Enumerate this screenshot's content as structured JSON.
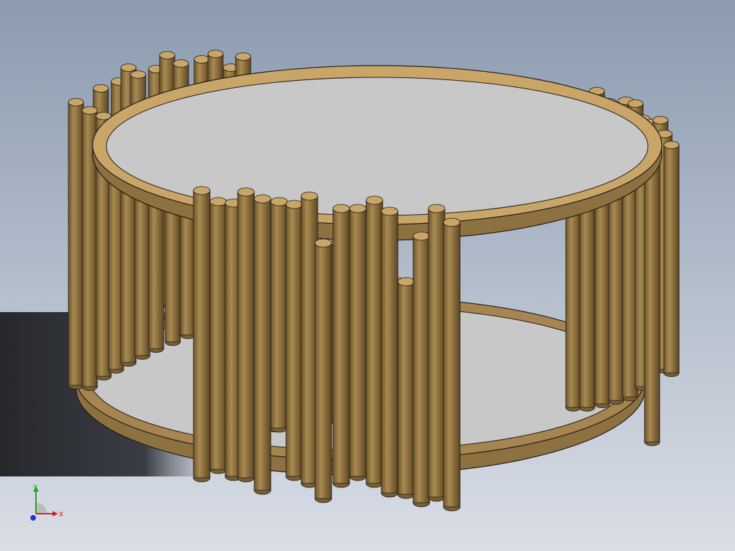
{
  "viewport": {
    "background_top": "#8c9bb0",
    "background_bottom": "#d9dee6",
    "shadow_color": "#2a2c30"
  },
  "model": {
    "frame_color": "#a68550",
    "frame_dark": "#7a5f33",
    "frame_top": "#c9a567",
    "glass_color": "#c8c8c8",
    "outline_color": "#1a1a1a"
  },
  "triad": {
    "x_label": "X",
    "y_label": "Y",
    "x_color": "#d02020",
    "y_color": "#20a020",
    "z_color": "#2030d0"
  }
}
